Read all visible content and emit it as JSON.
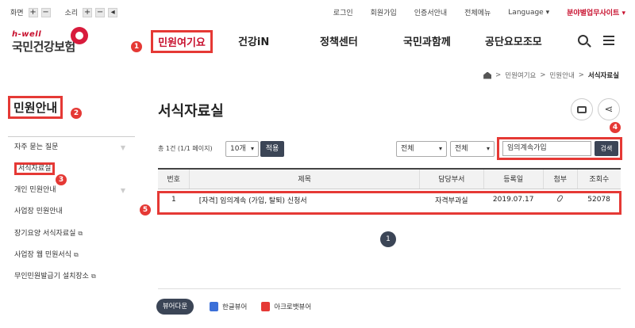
{
  "util": {
    "screen_label": "화면",
    "sound_label": "소리",
    "plus": "+",
    "minus": "−",
    "links": [
      "로그인",
      "회원가입",
      "인증서안내",
      "전체메뉴",
      "Language ▾",
      "분야별업무사이트 ▾"
    ]
  },
  "logo": {
    "en": "h-well",
    "ko": "국민건강보험"
  },
  "gnb": [
    "민원여기요",
    "건강iN",
    "정책센터",
    "국민과함께",
    "공단요모조모"
  ],
  "breadcrumb": {
    "items": [
      "민원여기요",
      "민원안내"
    ],
    "current": "서식자료실",
    "sep": ">"
  },
  "sidebar": {
    "title": "민원안내",
    "items": [
      {
        "label": "자주 묻는 질문",
        "arrow": "▼"
      },
      {
        "label": "서식자료실"
      },
      {
        "label": "개인 민원안내",
        "arrow": "▼"
      },
      {
        "label": "사업장 민원안내"
      },
      {
        "label": "장기요양 서식자료실",
        "ext": "⧉"
      },
      {
        "label": "사업장 웹 민원서식",
        "ext": "⧉"
      },
      {
        "label": "무인민원발급기 설치장소",
        "ext": "⧉"
      }
    ]
  },
  "main": {
    "title": "서식자료실",
    "count_text": "총 1건 (1/1 페이지)",
    "per_page": "10개",
    "apply_label": "적용",
    "filter1": "전체",
    "filter2": "전체",
    "search_value": "임의계속가입",
    "search_label": "검색",
    "columns": [
      "번호",
      "제목",
      "담당부서",
      "등록일",
      "첨부",
      "조회수"
    ],
    "rows": [
      {
        "no": "1",
        "title": "[자격] 임의계속 (가입, 탈퇴) 신청서",
        "dept": "자격부과실",
        "date": "2019.07.17",
        "views": "52078"
      }
    ],
    "page": "1"
  },
  "viewers": {
    "label": "뷰어다운",
    "hwp": "한글뷰어",
    "pdf": "아크로뱃뷰어"
  },
  "annotations": [
    "1",
    "2",
    "3",
    "4",
    "5"
  ],
  "colors": {
    "accent": "#c8102e",
    "highlight": "#e53935",
    "dark_button": "#3b4556"
  }
}
